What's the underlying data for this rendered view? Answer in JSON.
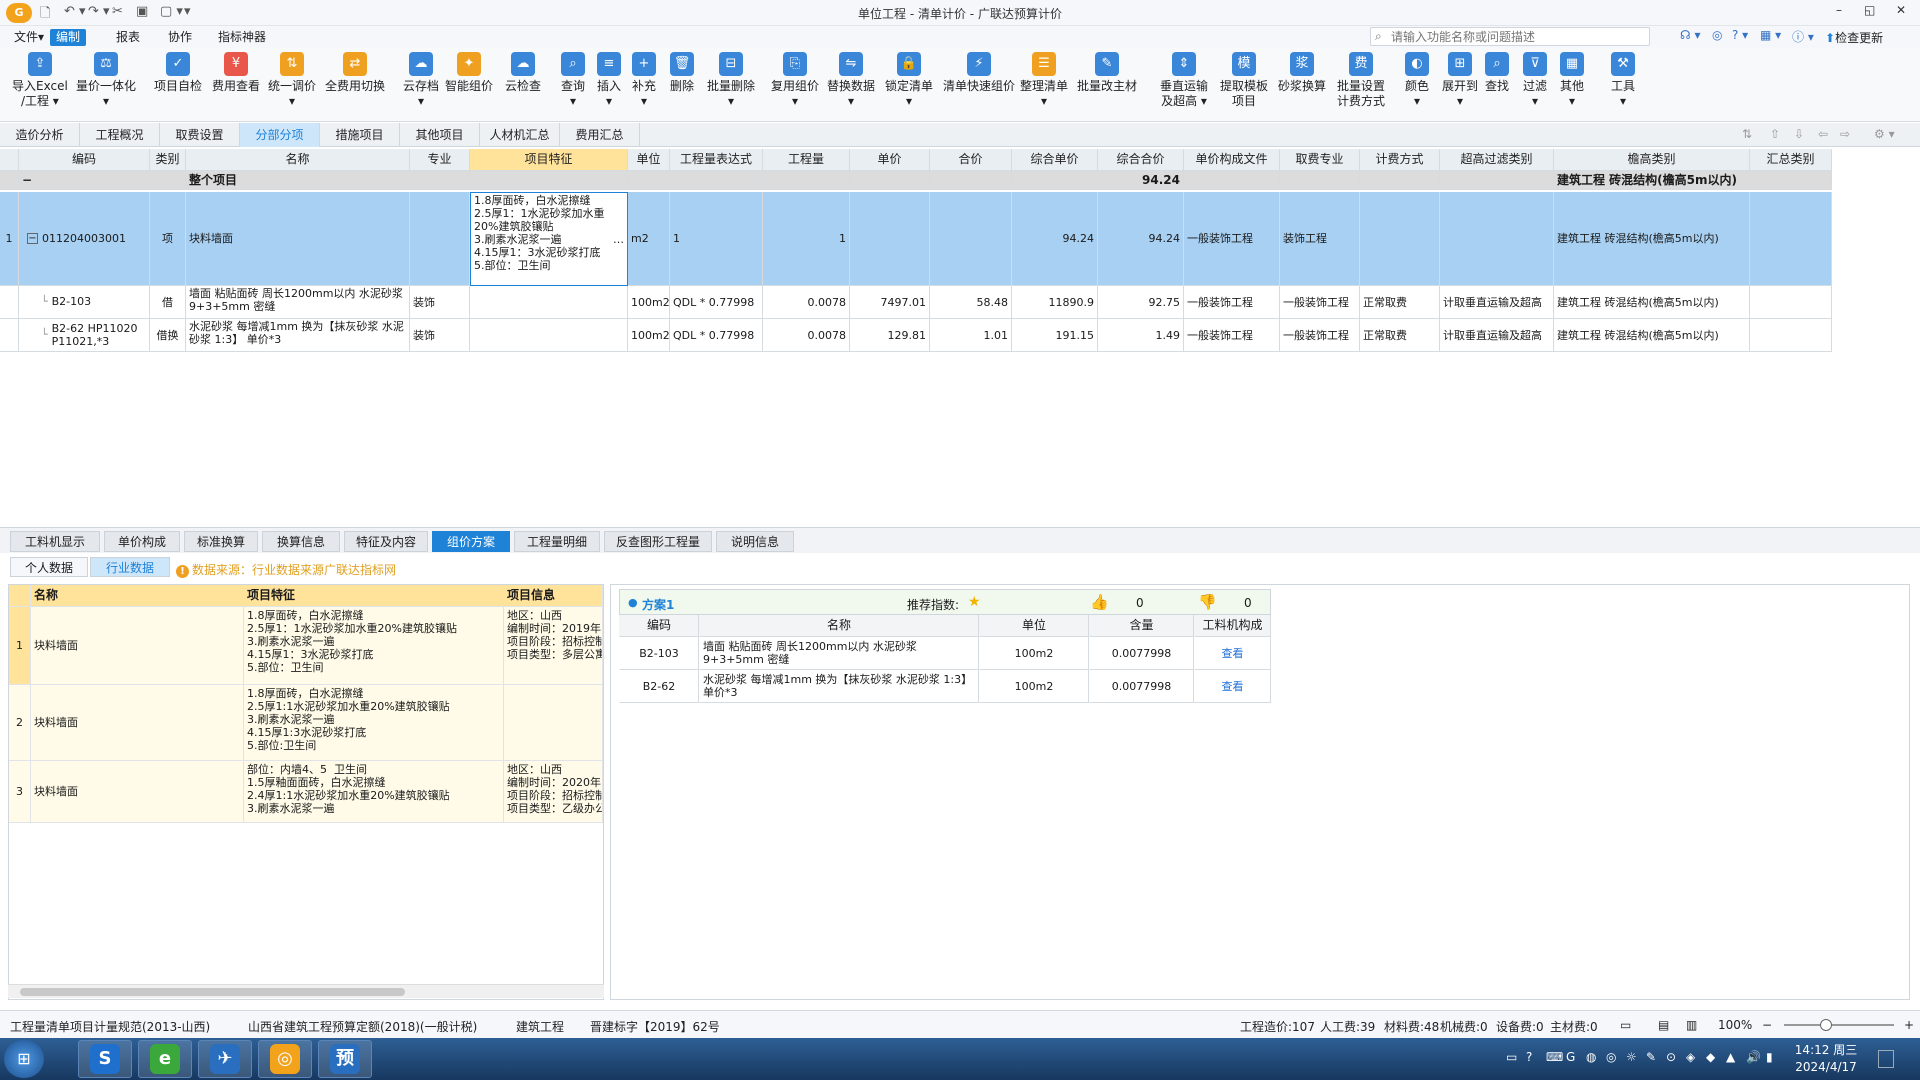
{
  "window": {
    "title": "单位工程 - 清单计价 - 广联达预算计价",
    "min": "–",
    "restore": "◱",
    "close": "✕"
  },
  "quick_access": [
    "🗋",
    "↶ ▾",
    "↷ ▾",
    "✂",
    "▣",
    "▢ ▾",
    "▾"
  ],
  "menu": [
    "文件▾",
    "编制",
    "报表",
    "协作",
    "指标神器"
  ],
  "menu_active": 1,
  "search": {
    "placeholder": "请输入功能名称或问题描述"
  },
  "right_tools": [
    "☊ ▾",
    "◎",
    "? ▾",
    "▦ ▾",
    "ⓘ ▾"
  ],
  "check_update": "检查更新",
  "ribbon": [
    {
      "label": "导入Excel\n/工程 ▾",
      "color": "#3a86d8",
      "icon": "⇪"
    },
    {
      "label": "量价一体化\n▾",
      "color": "#3a86d8",
      "icon": "⚖"
    },
    {
      "label": "项目自检",
      "color": "#3a86d8",
      "icon": "✓"
    },
    {
      "label": "费用查看",
      "color": "#e8574a",
      "icon": "¥"
    },
    {
      "label": "统一调价\n▾",
      "color": "#f0a020",
      "icon": "⇅"
    },
    {
      "label": "全费用切换",
      "color": "#f0a020",
      "icon": "⇄"
    },
    {
      "label": "云存档\n▾",
      "color": "#3a86d8",
      "icon": "☁"
    },
    {
      "label": "智能组价",
      "color": "#f0a020",
      "icon": "✦"
    },
    {
      "label": "云检查",
      "color": "#3a86d8",
      "icon": "☁"
    },
    {
      "label": "查询\n▾",
      "color": "#3a86d8",
      "icon": "⌕"
    },
    {
      "label": "插入\n▾",
      "color": "#3a86d8",
      "icon": "≡"
    },
    {
      "label": "补充\n▾",
      "color": "#3a86d8",
      "icon": "+"
    },
    {
      "label": "删除",
      "color": "#3a86d8",
      "icon": "🗑"
    },
    {
      "label": "批量删除\n▾",
      "color": "#3a86d8",
      "icon": "⊟"
    },
    {
      "label": "复用组价\n▾",
      "color": "#3a86d8",
      "icon": "⎘"
    },
    {
      "label": "替换数据\n▾",
      "color": "#3a86d8",
      "icon": "⇋"
    },
    {
      "label": "锁定清单\n▾",
      "color": "#3a86d8",
      "icon": "🔒"
    },
    {
      "label": "清单快速组价",
      "color": "#3a86d8",
      "icon": "⚡"
    },
    {
      "label": "整理清单\n▾",
      "color": "#f0a020",
      "icon": "☰"
    },
    {
      "label": "批量改主材",
      "color": "#3a86d8",
      "icon": "✎"
    },
    {
      "label": "垂直运输\n及超高 ▾",
      "color": "#3a86d8",
      "icon": "⇕"
    },
    {
      "label": "提取模板\n项目",
      "color": "#3a86d8",
      "icon": "模"
    },
    {
      "label": "砂浆换算",
      "color": "#3a86d8",
      "icon": "浆"
    },
    {
      "label": "批量设置\n计费方式",
      "color": "#3a86d8",
      "icon": "费"
    },
    {
      "label": "颜色\n▾",
      "color": "#3a86d8",
      "icon": "◐"
    },
    {
      "label": "展开到\n▾",
      "color": "#3a86d8",
      "icon": "⊞"
    },
    {
      "label": "查找",
      "color": "#3a86d8",
      "icon": "⌕"
    },
    {
      "label": "过滤\n▾",
      "color": "#3a86d8",
      "icon": "⊽"
    },
    {
      "label": "其他\n▾",
      "color": "#3a86d8",
      "icon": "▦"
    },
    {
      "label": "工具\n▾",
      "color": "#3a86d8",
      "icon": "⚒"
    }
  ],
  "tabs": [
    "造价分析",
    "工程概况",
    "取费设置",
    "分部分项",
    "措施项目",
    "其他项目",
    "人材机汇总",
    "费用汇总"
  ],
  "active_tab": 3,
  "nav_arrows": [
    "⇅",
    "⇧",
    "⇩",
    "⇦",
    "⇨",
    "⚙ ▾"
  ],
  "grid": {
    "headers": [
      "",
      "编码",
      "类别",
      "名称",
      "专业",
      "项目特征",
      "单位",
      "工程量表达式",
      "工程量",
      "单价",
      "合价",
      "综合单价",
      "综合合价",
      "单价构成文件",
      "取费专业",
      "计费方式",
      "超高过滤类别",
      "檐高类别",
      "汇总类别"
    ],
    "group": {
      "toggle": "−",
      "label": "整个项目",
      "total": "94.24",
      "eaves": "建筑工程 砖混结构(檐高5m以内)"
    },
    "rows": [
      {
        "no": "1",
        "toggle": "−",
        "code": "011204003001",
        "type": "项",
        "name": "块料墙面",
        "spec": "",
        "features": "1.8厚面砖，白水泥擦缝\n2.5厚1：1水泥砂浆加水重20%建筑胶镶贴\n3.刷素水泥浆一遍\n4.15厚1：3水泥砂浆打底\n5.部位：卫生间",
        "more": "…",
        "unit": "m2",
        "expr": "1",
        "qty": "1",
        "price": "",
        "amount": "",
        "comp_price": "94.24",
        "comp_amount": "94.24",
        "price_file": "一般装饰工程",
        "fee_spec": "装饰工程",
        "fee_method": "",
        "ov_filter": "",
        "eaves": "建筑工程 砖混结构(檐高5m以内)",
        "sum": ""
      },
      {
        "no": "",
        "toggle": "",
        "code": "B2-103",
        "type": "借",
        "name": "墙面 粘贴面砖 周长1200mm以内 水泥砂浆 9+3+5mm 密缝",
        "spec": "装饰",
        "features": "",
        "more": "",
        "unit": "100m2",
        "expr": "QDL * 0.77998",
        "qty": "0.0078",
        "price": "7497.01",
        "amount": "58.48",
        "comp_price": "11890.9",
        "comp_amount": "92.75",
        "price_file": "一般装饰工程",
        "fee_spec": "一般装饰工程",
        "fee_method": "正常取费",
        "ov_filter": "计取垂直运输及超高",
        "eaves": "建筑工程 砖混结构(檐高5m以内)",
        "sum": ""
      },
      {
        "no": "",
        "toggle": "",
        "code": "B2-62 HP11020 P11021,*3",
        "type": "借换",
        "name": "水泥砂浆 每增减1mm  换为【抹灰砂浆 水泥砂浆 1:3】 单价*3",
        "spec": "装饰",
        "features": "",
        "more": "",
        "unit": "100m2",
        "expr": "QDL * 0.77998",
        "qty": "0.0078",
        "price": "129.81",
        "amount": "1.01",
        "comp_price": "191.15",
        "comp_amount": "1.49",
        "price_file": "一般装饰工程",
        "fee_spec": "一般装饰工程",
        "fee_method": "正常取费",
        "ov_filter": "计取垂直运输及超高",
        "eaves": "建筑工程 砖混结构(檐高5m以内)",
        "sum": ""
      }
    ]
  },
  "lower_tabs": [
    "工料机显示",
    "单价构成",
    "标准换算",
    "换算信息",
    "特征及内容",
    "组价方案",
    "工程量明细",
    "反查图形工程量",
    "说明信息"
  ],
  "lower_active": 5,
  "sub_tabs": [
    "个人数据",
    "行业数据"
  ],
  "sub_active": 1,
  "warning": {
    "icon": "!",
    "text": "数据来源：行业数据来源广联达指标网"
  },
  "industry": {
    "headers": [
      "",
      "名称",
      "项目特征",
      "项目信息"
    ],
    "rows": [
      {
        "no": "1",
        "name": "块料墙面",
        "features": "1.8厚面砖，白水泥擦缝\n2.5厚1：1水泥砂浆加水重20%建筑胶镶贴\n3.刷素水泥浆一遍\n4.15厚1：3水泥砂浆打底\n5.部位：卫生间",
        "info": "地区：山西\n编制时间：2019年1\n项目阶段：招标控制\n项目类型：多层公寓"
      },
      {
        "no": "2",
        "name": "块料墙面",
        "features": "1.8厚面砖，白水泥擦缝\n2.5厚1:1水泥砂浆加水重20%建筑胶镶贴\n3.刷素水泥浆一遍\n4.15厚1:3水泥砂浆打底\n5.部位:卫生间",
        "info": ""
      },
      {
        "no": "3",
        "name": "块料墙面",
        "features": "部位：内墙4、5  卫生间\n1.5厚釉面面砖，白水泥擦缝\n2.4厚1:1水泥砂浆加水重20%建筑胶镶贴\n3.刷素水泥浆一遍",
        "info": "地区：山西\n编制时间：2020年1\n项目阶段：招标控制\n项目类型：乙级办公"
      }
    ]
  },
  "plan": {
    "title": "方案1",
    "rec_label": "推荐指数:",
    "star": "★",
    "likes": "0",
    "dislikes": "0",
    "headers": [
      "编码",
      "名称",
      "单位",
      "含量",
      "工料机构成"
    ],
    "rows": [
      {
        "code": "B2-103",
        "name": "墙面 粘贴面砖 周长1200mm以内 水泥砂浆 9+3+5mm 密缝",
        "unit": "100m2",
        "qty": "0.0077998",
        "link": "查看"
      },
      {
        "code": "B2-62",
        "name": "水泥砂浆 每增减1mm  换为【抹灰砂浆 水泥砂浆 1:3】 单价*3",
        "unit": "100m2",
        "qty": "0.0077998",
        "link": "查看"
      }
    ]
  },
  "status": {
    "items": [
      "工程量清单项目计量规范(2013-山西)",
      "山西省建筑工程预算定额(2018)(一般计税)",
      "建筑工程",
      "晋建标字【2019】62号"
    ],
    "right": [
      "工程造价:107",
      "人工费:39",
      "材料费:48",
      "机械费:0",
      "设备费:0",
      "主材费:0"
    ],
    "zoom": "100%"
  },
  "taskbar": {
    "apps": [
      "S",
      "e",
      "✈",
      "◎",
      "预"
    ],
    "clock_time": "14:12 周三",
    "clock_date": "2024/4/17"
  }
}
